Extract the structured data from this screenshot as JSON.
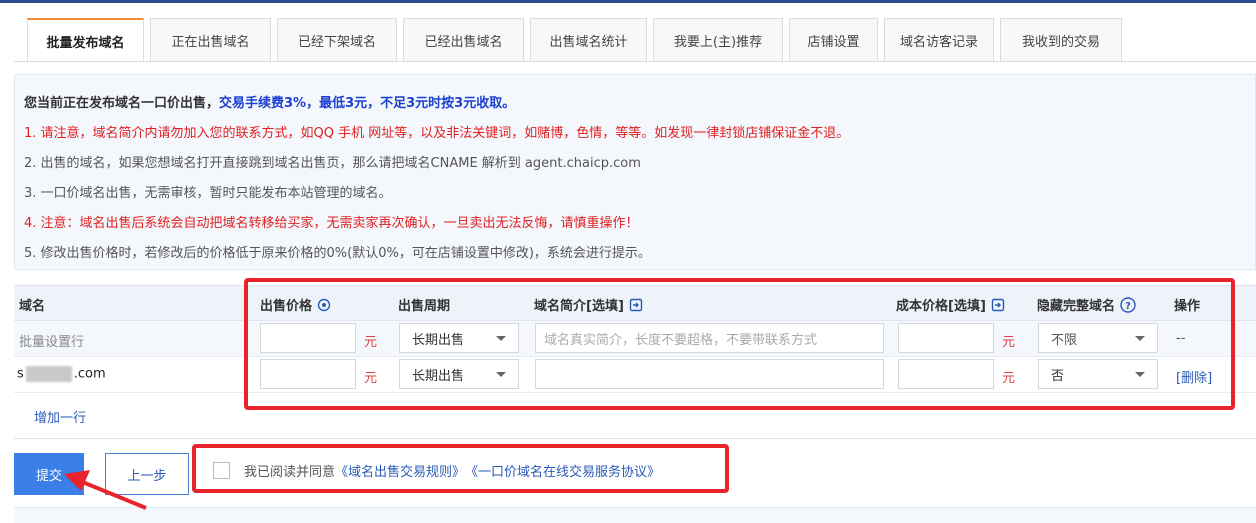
{
  "tabs": [
    {
      "label": "批量发布域名",
      "active": true
    },
    {
      "label": "正在出售域名"
    },
    {
      "label": "已经下架域名"
    },
    {
      "label": "已经出售域名"
    },
    {
      "label": "出售域名统计"
    },
    {
      "label": "我要上(主)推荐"
    },
    {
      "label": "店铺设置"
    },
    {
      "label": "域名访客记录"
    },
    {
      "label": "我收到的交易"
    }
  ],
  "notice": {
    "intro": "您当前正在发布域名一口价出售，",
    "fee": "交易手续费3%，最低3元，不足3元时按3元收取。",
    "line1": "1. 请注意，域名简介内请勿加入您的联系方式，如QQ 手机 网址等，以及非法关键词，如赌博，色情，等等。如发现一律封锁店铺保证金不退。",
    "line2": "2. 出售的域名，如果您想域名打开直接跳到域名出售页，那么请把域名CNAME 解析到 agent.chaicp.com",
    "line3": "3. 一口价域名出售，无需审核，暂时只能发布本站管理的域名。",
    "line4": "4. 注意：域名出售后系统会自动把域名转移给买家，无需卖家再次确认，一旦卖出无法反悔，请慎重操作！",
    "line5": "5. 修改出售价格时，若修改后的价格低于原来价格的0%(默认0%，可在店铺设置中修改)，系统会进行提示。"
  },
  "table": {
    "headers": {
      "domain": "域名",
      "price": "出售价格",
      "period": "出售周期",
      "intro": "域名简介[选填]",
      "cost": "成本价格[选填]",
      "hide": "隐藏完整域名",
      "action": "操作"
    },
    "unit": "元",
    "batch_row": {
      "label": "批量设置行",
      "period": "长期出售",
      "intro_placeholder": "域名真实简介，长度不要超格，不要带联系方式",
      "hide": "不限",
      "action": "--"
    },
    "data_row": {
      "domain_prefix": "s",
      "domain_suffix": ".com",
      "period": "长期出售",
      "hide": "否",
      "action": "[删除]"
    },
    "add_row": "增加一行"
  },
  "buttons": {
    "submit": "提交",
    "prev": "上一步"
  },
  "agree": {
    "text": "我已阅读并同意",
    "rule": "《域名出售交易规则》",
    "protocol": "《一口价域名在线交易服务协议》"
  },
  "colors": {
    "accent": "#3a7ee8",
    "highlight": "#e8232b",
    "warning": "#e02020",
    "fee": "#1a3fd1"
  }
}
